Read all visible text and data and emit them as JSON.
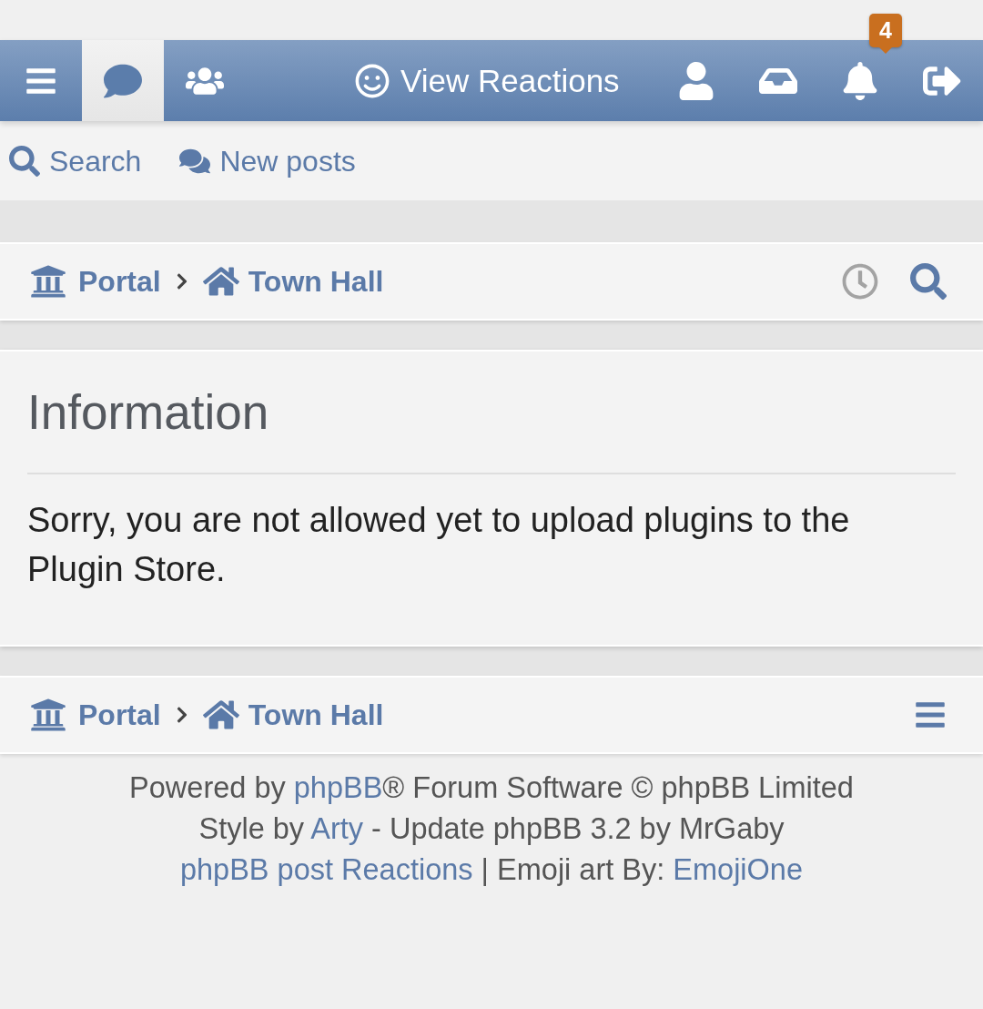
{
  "nav_bar": {
    "items": [
      {
        "kind": "menu",
        "selected": false
      },
      {
        "kind": "chat",
        "selected": true
      },
      {
        "kind": "members",
        "selected": false
      },
      {
        "kind": "reactions",
        "label": "View Reactions",
        "selected": false
      },
      {
        "kind": "profile",
        "selected": false
      },
      {
        "kind": "inbox",
        "selected": false
      },
      {
        "kind": "notifications",
        "badge": "4",
        "selected": false
      },
      {
        "kind": "logout",
        "selected": false
      }
    ]
  },
  "quick_links": [
    {
      "kind": "search",
      "label": "Search"
    },
    {
      "kind": "new_posts",
      "label": "New posts"
    }
  ],
  "breadcrumbs_top": {
    "crumbs": [
      {
        "kind": "portal",
        "label": "Portal"
      },
      {
        "kind": "forum",
        "label": "Town Hall"
      }
    ],
    "actions": [
      {
        "kind": "clock"
      },
      {
        "kind": "search"
      }
    ]
  },
  "message": {
    "title": "Information",
    "text": "Sorry, you are not allowed yet to upload plugins to the Plugin Store."
  },
  "breadcrumbs_bottom": {
    "crumbs": [
      {
        "kind": "portal",
        "label": "Portal"
      },
      {
        "kind": "forum",
        "label": "Town Hall"
      }
    ],
    "actions": [
      {
        "kind": "menu"
      }
    ]
  },
  "footer": {
    "lines": [
      {
        "segments": [
          {
            "text": "Powered by ",
            "link": false
          },
          {
            "text": "phpBB",
            "link": true
          },
          {
            "text": "® Forum Software © phpBB Limited",
            "link": false
          }
        ]
      },
      {
        "segments": [
          {
            "text": "Style by ",
            "link": false
          },
          {
            "text": "Arty",
            "link": true
          },
          {
            "text": " - Update phpBB 3.2 by MrGaby",
            "link": false
          }
        ]
      },
      {
        "segments": [
          {
            "text": "phpBB post Reactions",
            "link": true
          },
          {
            "text": " | Emoji art By: ",
            "link": false
          },
          {
            "text": "EmojiOne",
            "link": true
          }
        ]
      }
    ]
  }
}
